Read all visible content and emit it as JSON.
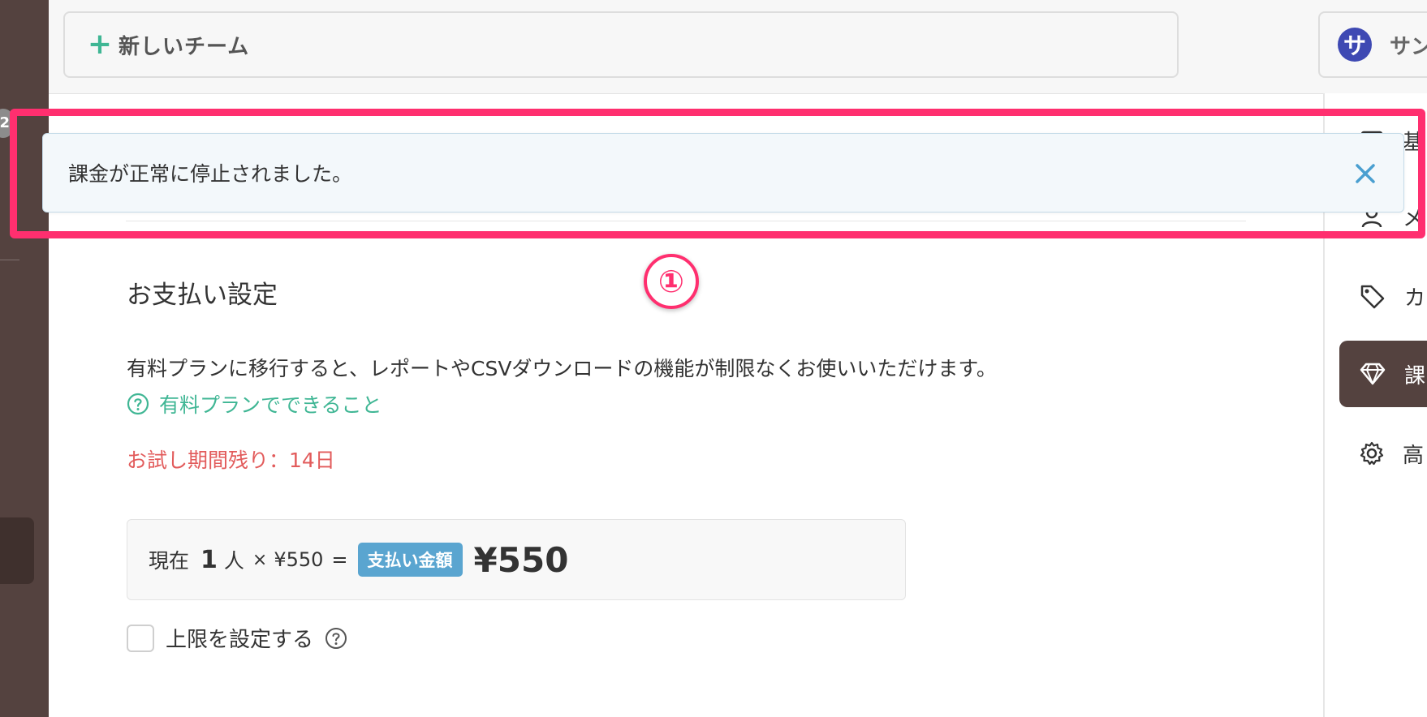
{
  "left_sidebar": {
    "badge_count": "2"
  },
  "header": {
    "new_team_label": "新しいチーム",
    "account_avatar_letter": "サ",
    "account_name": "サン"
  },
  "right_nav": {
    "items": [
      {
        "label": "基",
        "icon": "basic-info-icon"
      },
      {
        "label": "メ",
        "icon": "member-icon"
      },
      {
        "label": "カ",
        "icon": "tag-icon"
      },
      {
        "label": "課",
        "icon": "diamond-icon",
        "active": true
      },
      {
        "label": "高",
        "icon": "gear-icon"
      }
    ]
  },
  "notice": {
    "message": "課金が正常に停止されました。"
  },
  "annotation": {
    "step_marker": "①",
    "highlight_color": "#ff2f6f"
  },
  "billing": {
    "heading": "お支払い設定",
    "description": "有料プランに移行すると、レポートやCSVダウンロードの機能が制限なくお使いいただけます。",
    "paid_plan_link": "有料プランでできること",
    "trial_remaining": "お試し期間残り：14日",
    "price": {
      "current_label": "現在",
      "count": "1",
      "unit": "人",
      "times": "×",
      "per_person": "¥550",
      "equals": "=",
      "badge": "支払い金額",
      "total": "¥550"
    },
    "limit_checkbox_label": "上限を設定する",
    "limit_checked": false
  },
  "colors": {
    "sidebar_bg": "#54423f",
    "accent_green": "#3fb694",
    "accent_blue": "#5aa5d0",
    "warning_red": "#e25b5b",
    "avatar_blue": "#3e49b3"
  }
}
